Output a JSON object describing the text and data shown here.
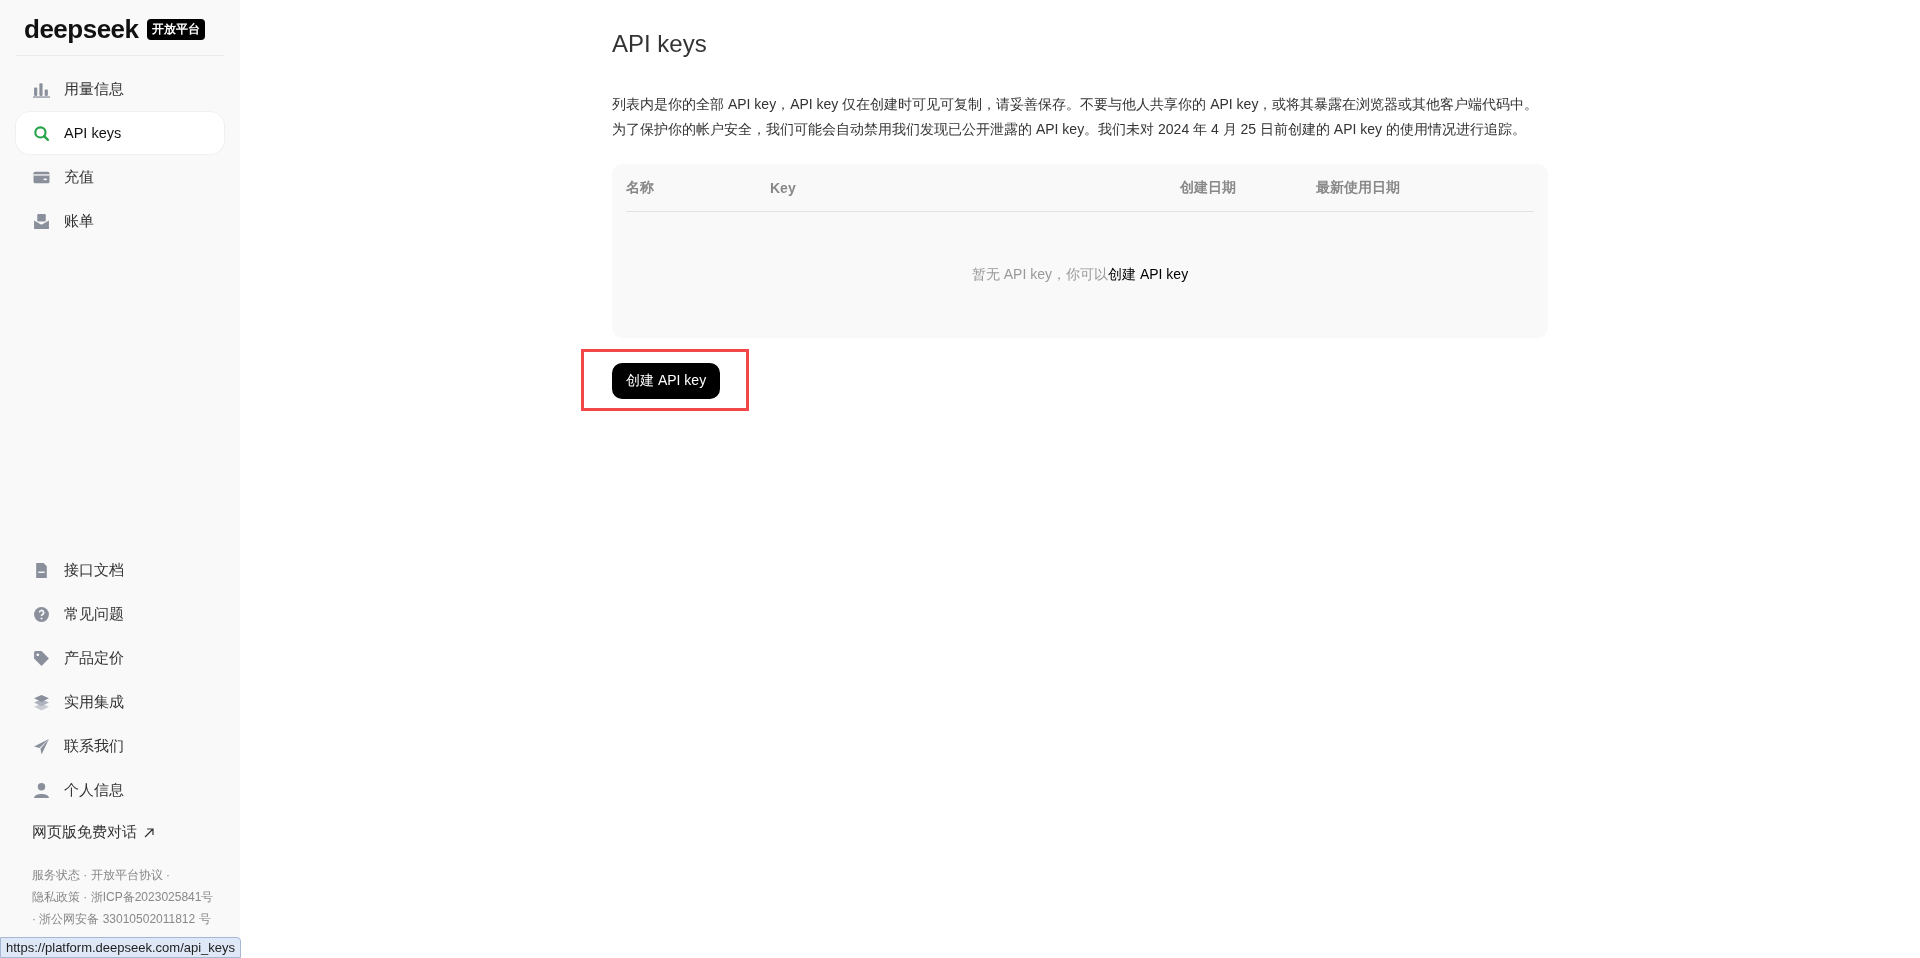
{
  "sidebar": {
    "logo": "deepseek",
    "badge": "开放平台",
    "nav_items": [
      {
        "label": "用量信息",
        "selected": false
      },
      {
        "label": "API keys",
        "selected": true
      },
      {
        "label": "充值",
        "selected": false
      },
      {
        "label": "账单",
        "selected": false
      }
    ],
    "bottom_items": [
      {
        "label": "接口文档"
      },
      {
        "label": "常见问题"
      },
      {
        "label": "产品定价"
      },
      {
        "label": "实用集成"
      },
      {
        "label": "联系我们"
      },
      {
        "label": "个人信息"
      }
    ],
    "web_chat_link": "网页版免费对话",
    "footer_separator": "·",
    "footer_links": [
      "服务状态",
      "开放平台协议",
      "隐私政策",
      "浙ICP备2023025841号",
      "浙公网安备 33010502011812 号"
    ]
  },
  "main": {
    "title": "API keys",
    "description": [
      "列表内是你的全部 API key，API key 仅在创建时可见可复制，请妥善保存。不要与他人共享你的 API key，或将其暴露在浏览器或其他客户端代码中。",
      "为了保护你的帐户安全，我们可能会自动禁用我们发现已公开泄露的 API key。我们未对 2024 年 4 月 25 日前创建的 API key 的使用情况进行追踪。"
    ],
    "table": {
      "columns": [
        "名称",
        "Key",
        "创建日期",
        "最新使用日期"
      ],
      "empty_text": "暂无 API key，你可以",
      "empty_link": "创建 API key"
    },
    "create_button": {
      "label": "创建 API key",
      "highlighted": true
    }
  },
  "status_bar": {
    "url": "https://platform.deepseek.com/api_keys"
  }
}
